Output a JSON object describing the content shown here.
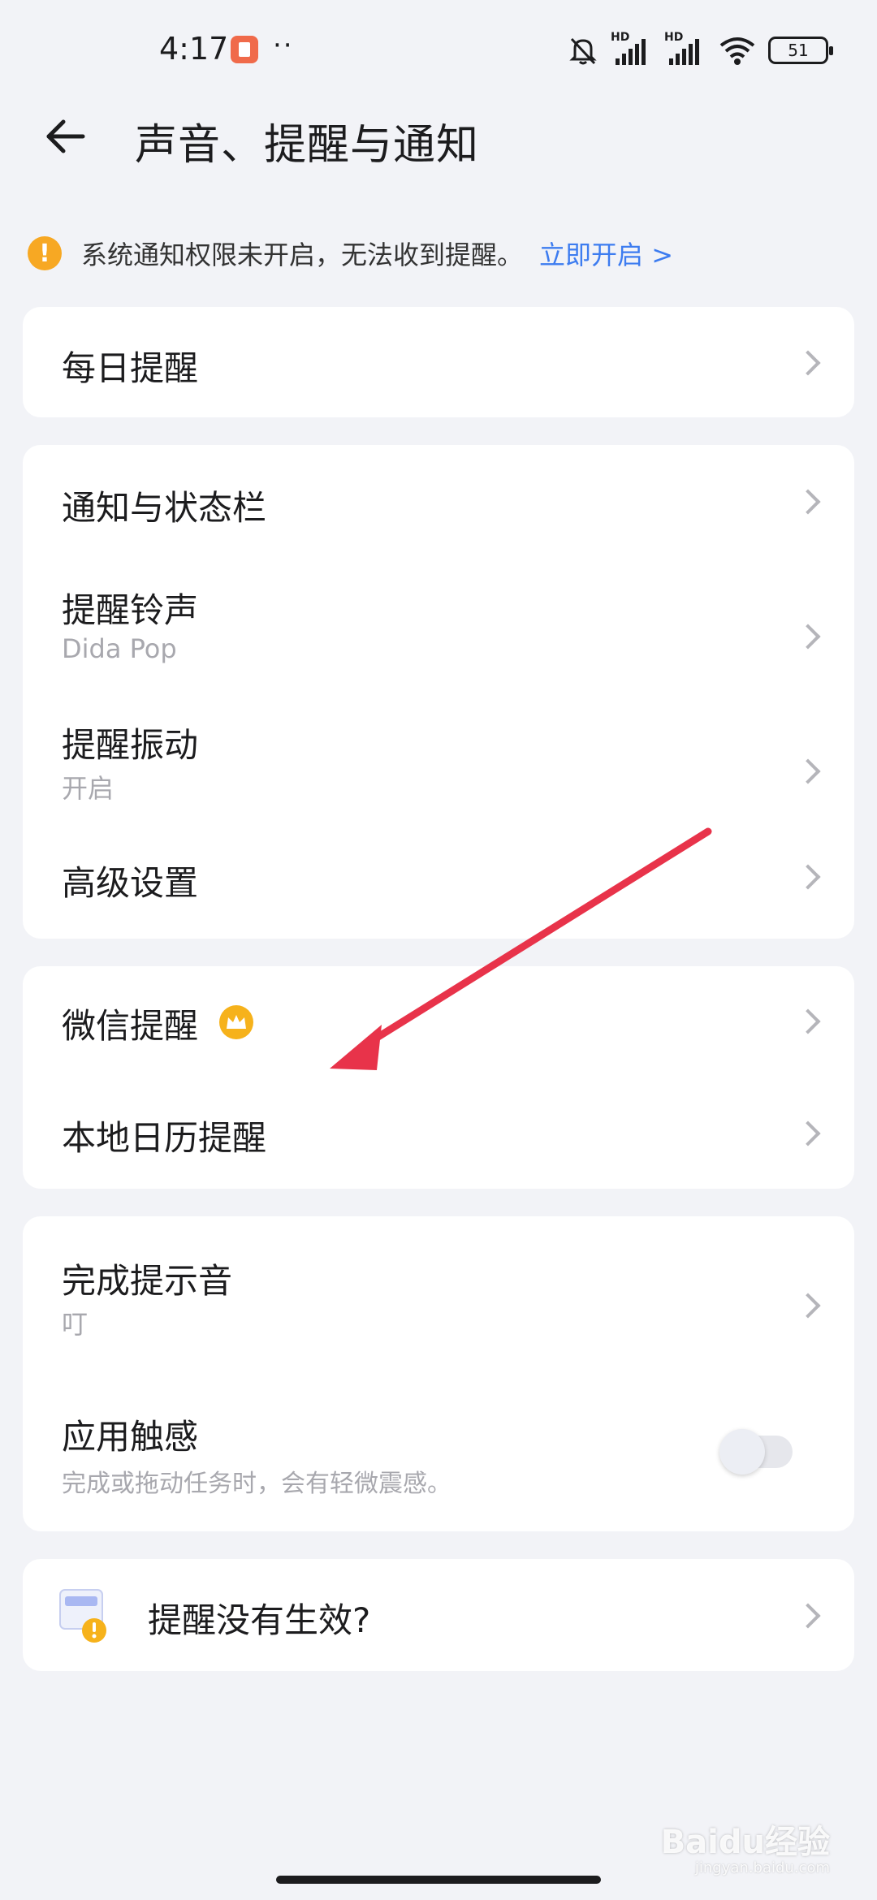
{
  "status_bar": {
    "time": "4:17",
    "dots": "··",
    "signal1_label": "HD",
    "signal2_label": "HD",
    "battery": "51"
  },
  "header": {
    "title": "声音、提醒与通知"
  },
  "warning": {
    "icon": "!",
    "text": "系统通知权限未开启，无法收到提醒。",
    "link": "立即开启 >"
  },
  "cards": {
    "daily": {
      "label": "每日提醒"
    },
    "notify": {
      "statusbar_label": "通知与状态栏",
      "ringtone_label": "提醒铃声",
      "ringtone_value": "Dida Pop",
      "vibration_label": "提醒振动",
      "vibration_value": "开启",
      "advanced_label": "高级设置"
    },
    "integrations": {
      "wechat_label": "微信提醒",
      "calendar_label": "本地日历提醒"
    },
    "feedback": {
      "complete_sound_label": "完成提示音",
      "complete_sound_value": "叮",
      "haptics_label": "应用触感",
      "haptics_desc": "完成或拖动任务时，会有轻微震感。",
      "haptics_on": false
    },
    "help": {
      "label": "提醒没有生效?"
    }
  },
  "watermark": {
    "text": "Baidu经验",
    "sub": "jingyan.baidu.com"
  },
  "colors": {
    "background": "#f2f3f7",
    "link": "#3d7cf0",
    "warning": "#f7a823",
    "crown": "#f6b21b",
    "arrow": "#e8334a"
  }
}
